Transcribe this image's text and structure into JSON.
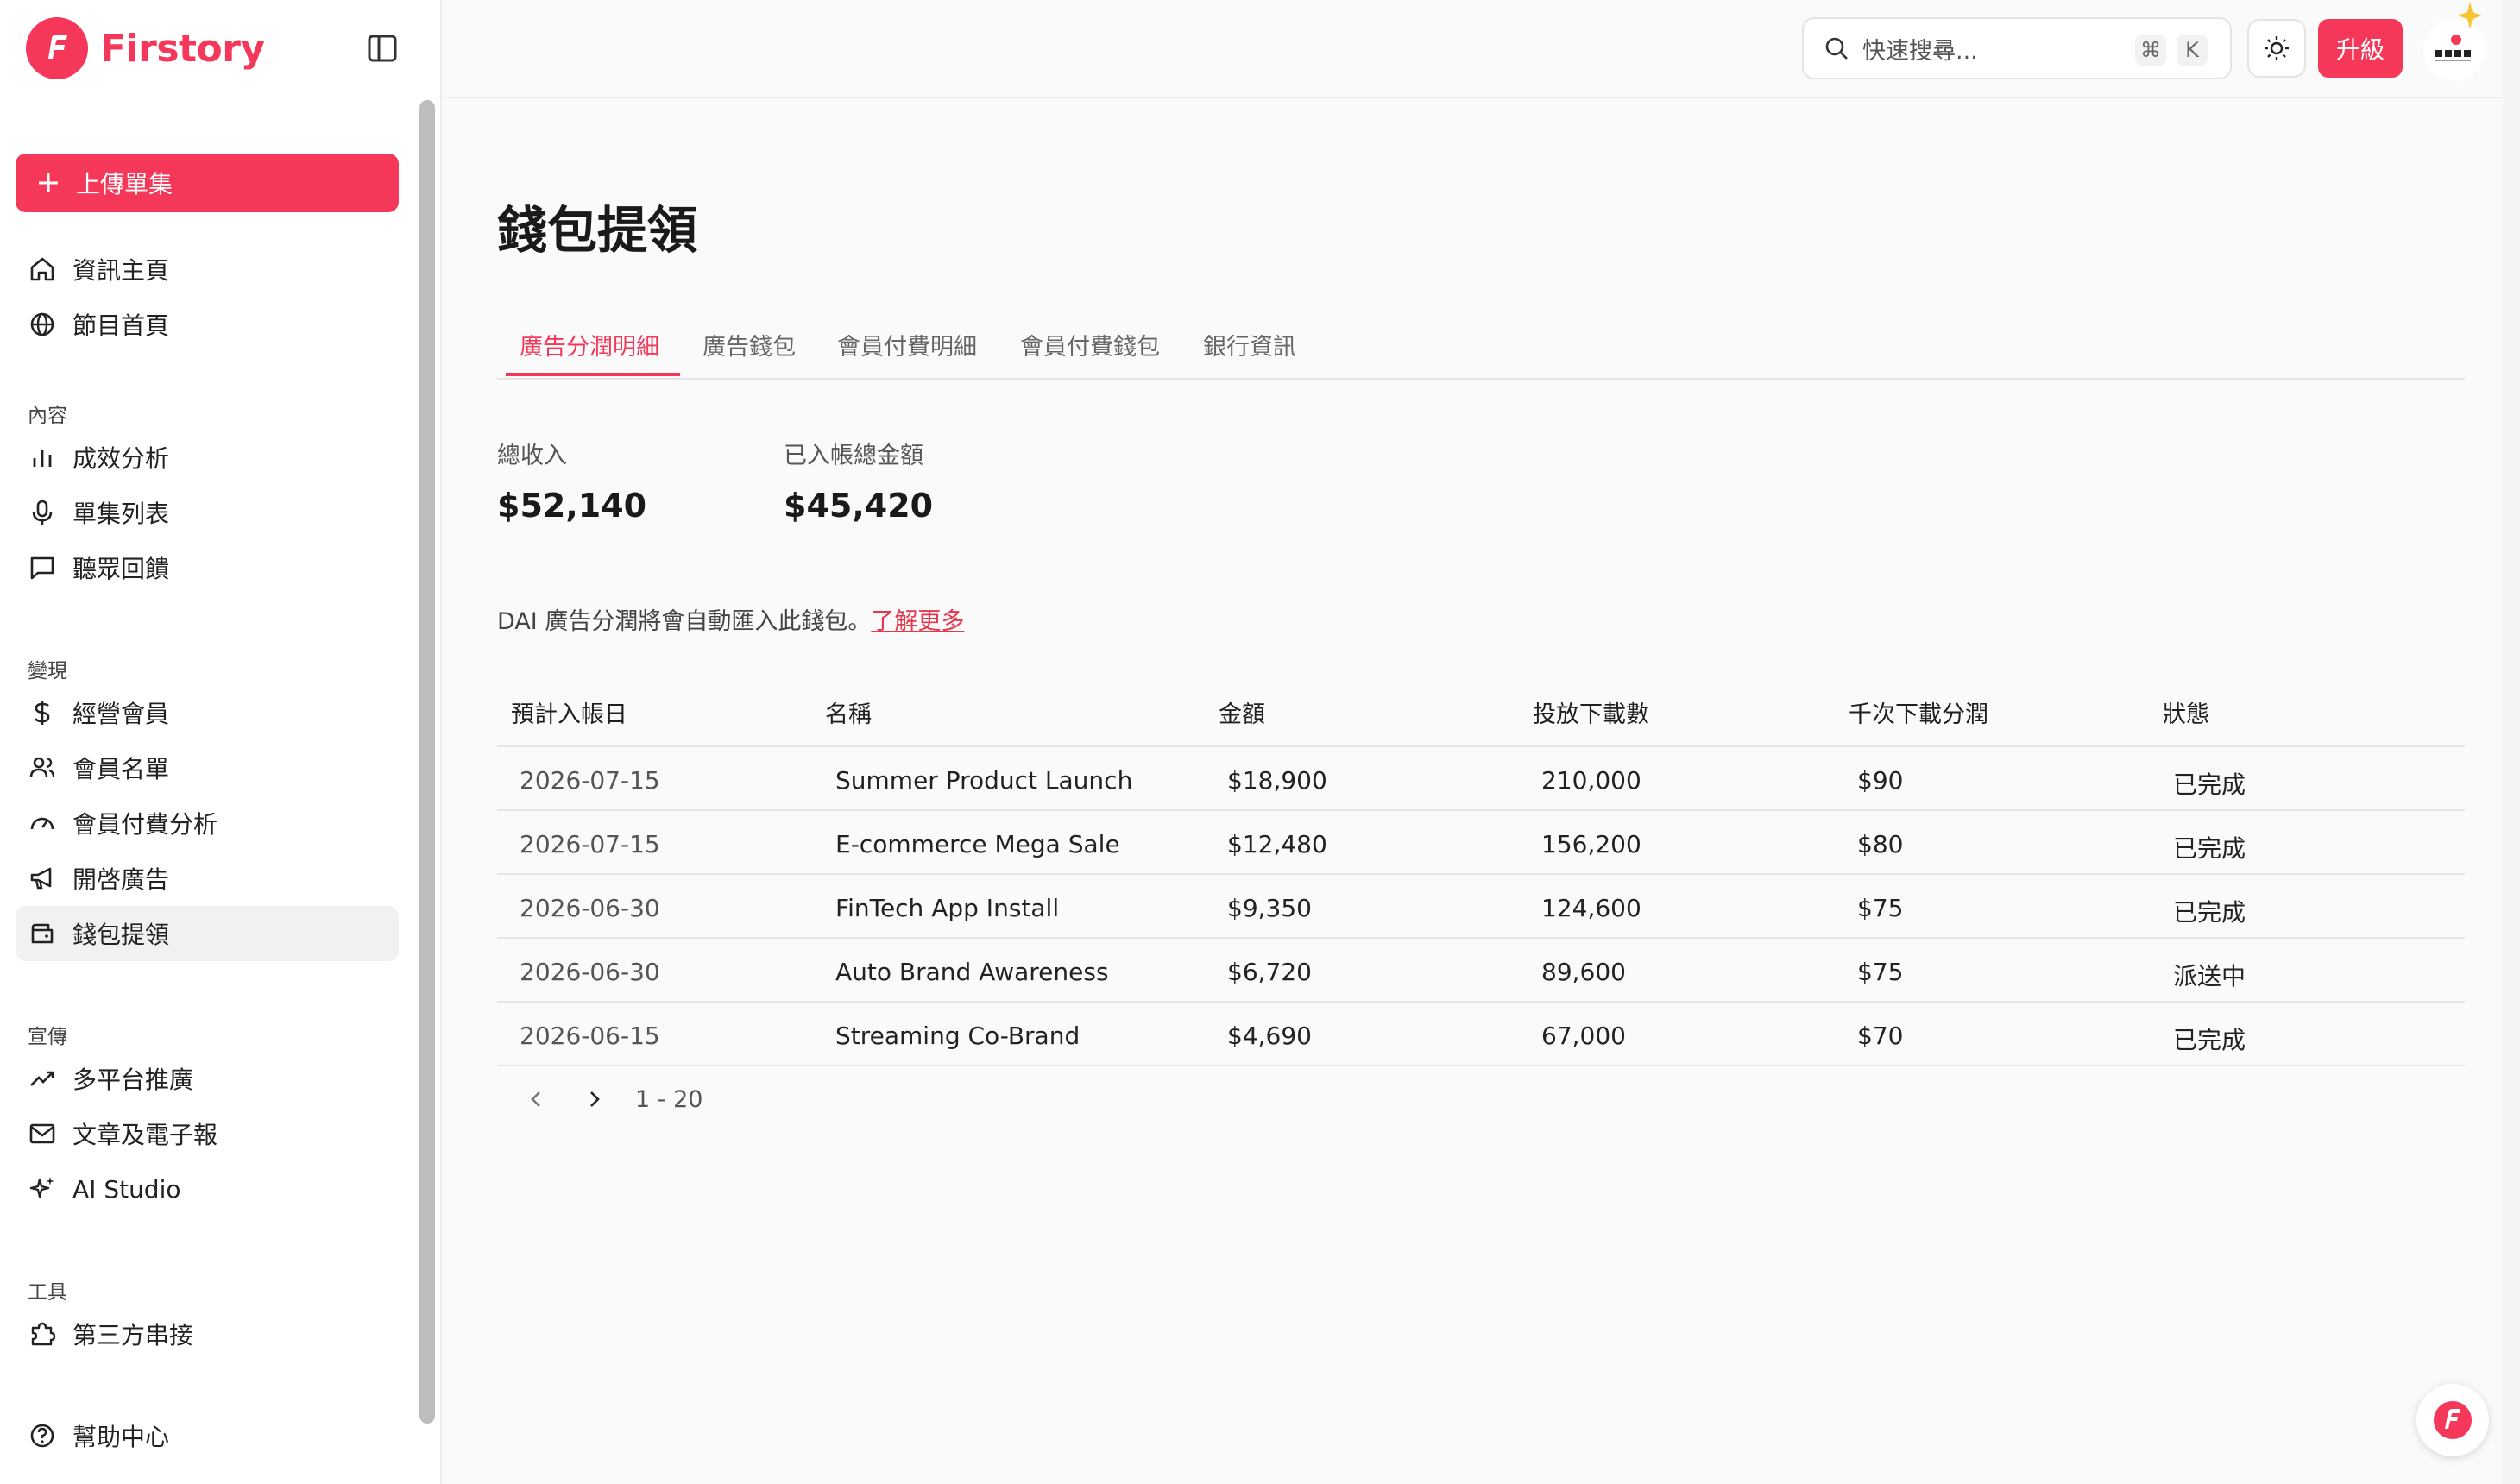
{
  "brand": {
    "name": "Firstory",
    "color": "#f5385a"
  },
  "sidebar": {
    "upload_label": "上傳單集",
    "top_items": [
      {
        "label": "資訊主頁",
        "icon": "home-icon"
      },
      {
        "label": "節目首頁",
        "icon": "globe-icon"
      }
    ],
    "sections": [
      {
        "title": "內容",
        "items": [
          {
            "label": "成效分析",
            "icon": "bar-chart-icon"
          },
          {
            "label": "單集列表",
            "icon": "microphone-icon"
          },
          {
            "label": "聽眾回饋",
            "icon": "message-icon"
          }
        ]
      },
      {
        "title": "變現",
        "items": [
          {
            "label": "經營會員",
            "icon": "dollar-icon"
          },
          {
            "label": "會員名單",
            "icon": "users-icon"
          },
          {
            "label": "會員付費分析",
            "icon": "gauge-icon"
          },
          {
            "label": "開啓廣告",
            "icon": "megaphone-icon"
          },
          {
            "label": "錢包提領",
            "icon": "wallet-icon",
            "active": true
          }
        ]
      },
      {
        "title": "宣傳",
        "items": [
          {
            "label": "多平台推廣",
            "icon": "trending-up-icon"
          },
          {
            "label": "文章及電子報",
            "icon": "mail-icon"
          },
          {
            "label": "AI Studio",
            "icon": "sparkles-icon"
          }
        ]
      },
      {
        "title": "工具",
        "items": [
          {
            "label": "第三方串接",
            "icon": "puzzle-icon"
          }
        ]
      }
    ],
    "help_label": "幫助中心"
  },
  "topbar": {
    "search_placeholder": "快速搜尋...",
    "shortcut_cmd": "⌘",
    "shortcut_key": "K",
    "upgrade_label": "升級"
  },
  "main": {
    "title": "錢包提領",
    "tabs": [
      {
        "label": "廣告分潤明細",
        "active": true
      },
      {
        "label": "廣告錢包"
      },
      {
        "label": "會員付費明細"
      },
      {
        "label": "會員付費錢包"
      },
      {
        "label": "銀行資訊"
      }
    ],
    "stats": [
      {
        "label": "總收入",
        "value": "$52,140"
      },
      {
        "label": "已入帳總金額",
        "value": "$45,420"
      }
    ],
    "notice_text": "DAI 廣告分潤將會自動匯入此錢包。",
    "notice_link": "了解更多",
    "table": {
      "headers": [
        "預計入帳日",
        "名稱",
        "金額",
        "投放下載數",
        "千次下載分潤",
        "狀態"
      ],
      "rows": [
        [
          "2026-07-15",
          "Summer Product Launch",
          "$18,900",
          "210,000",
          "$90",
          "已完成"
        ],
        [
          "2026-07-15",
          "E-commerce Mega Sale",
          "$12,480",
          "156,200",
          "$80",
          "已完成"
        ],
        [
          "2026-06-30",
          "FinTech App Install",
          "$9,350",
          "124,600",
          "$75",
          "已完成"
        ],
        [
          "2026-06-30",
          "Auto Brand Awareness",
          "$6,720",
          "89,600",
          "$75",
          "派送中"
        ],
        [
          "2026-06-15",
          "Streaming Co-Brand",
          "$4,690",
          "67,000",
          "$70",
          "已完成"
        ]
      ]
    },
    "pagination": {
      "range": "1 - 20"
    }
  }
}
